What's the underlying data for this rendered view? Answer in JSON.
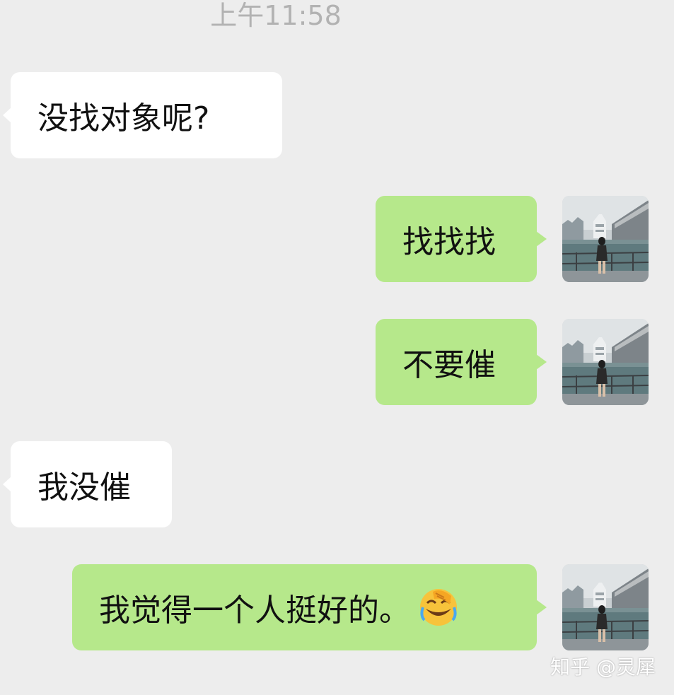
{
  "timestamp": "上午11:58",
  "messages": [
    {
      "side": "in",
      "text": "没找对象呢?"
    },
    {
      "side": "out",
      "text": "找找找"
    },
    {
      "side": "out",
      "text": "不要催"
    },
    {
      "side": "in",
      "text": "我没催"
    },
    {
      "side": "out",
      "text": "我觉得一个人挺好的。",
      "emoji": "face-with-tears-of-joy-hand-emoji"
    }
  ],
  "watermark": "知乎 @灵犀",
  "colors": {
    "background": "#ededed",
    "incoming_bubble": "#ffffff",
    "outgoing_bubble": "#b6e88b",
    "timestamp_text": "#b2b2b2",
    "message_text": "#111111"
  },
  "icons": {
    "avatar": "user-avatar-photo-icon"
  }
}
